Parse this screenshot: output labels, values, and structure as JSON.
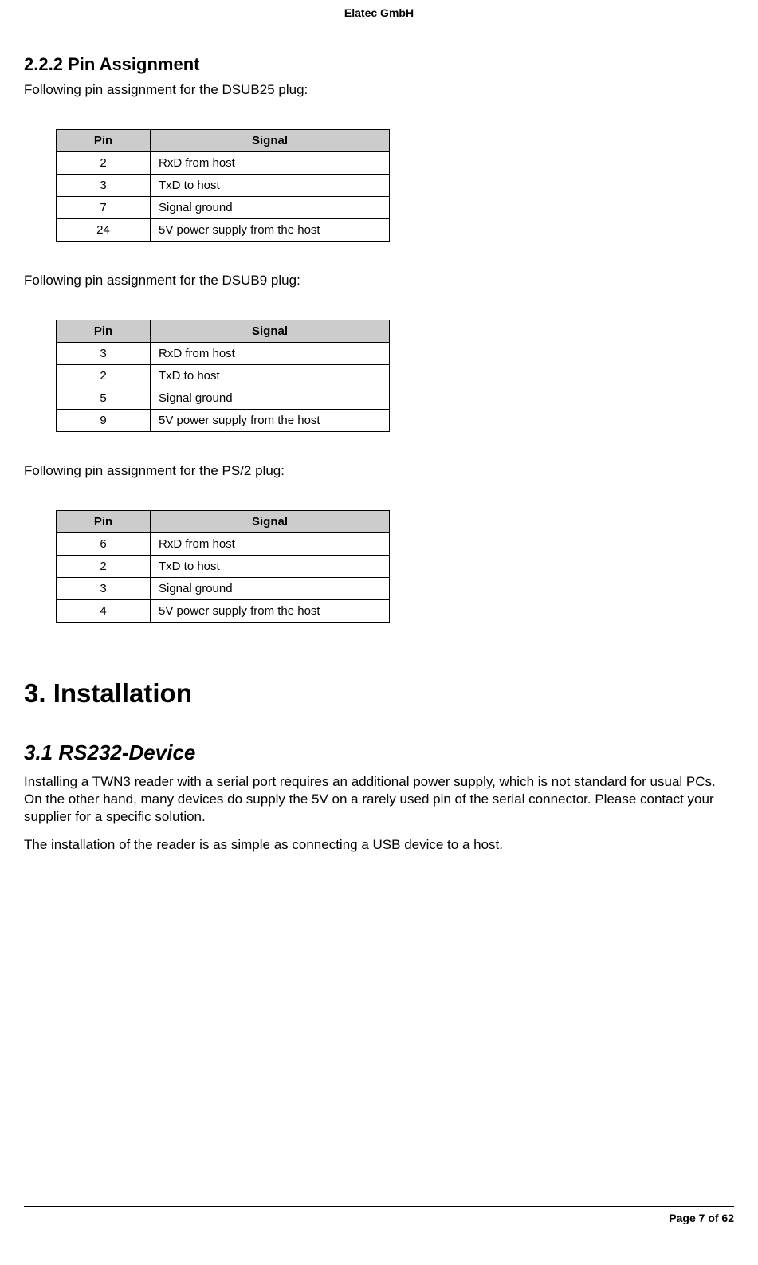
{
  "header": {
    "company": "Elatec GmbH"
  },
  "section_222": {
    "heading": "2.2.2  Pin Assignment",
    "intro_dsub25": "Following pin assignment for the DSUB25 plug:",
    "intro_dsub9": "Following pin assignment for the DSUB9 plug:",
    "intro_ps2": "Following pin assignment for the PS/2 plug:",
    "col_pin": "Pin",
    "col_signal": "Signal",
    "table_dsub25": [
      {
        "pin": "2",
        "signal": "RxD from host"
      },
      {
        "pin": "3",
        "signal": "TxD to host"
      },
      {
        "pin": "7",
        "signal": "Signal ground"
      },
      {
        "pin": "24",
        "signal": "5V power supply from the host"
      }
    ],
    "table_dsub9": [
      {
        "pin": "3",
        "signal": "RxD from host"
      },
      {
        "pin": "2",
        "signal": "TxD to host"
      },
      {
        "pin": "5",
        "signal": "Signal ground"
      },
      {
        "pin": "9",
        "signal": "5V power supply from the host"
      }
    ],
    "table_ps2": [
      {
        "pin": "6",
        "signal": "RxD from host"
      },
      {
        "pin": "2",
        "signal": "TxD to host"
      },
      {
        "pin": "3",
        "signal": "Signal ground"
      },
      {
        "pin": "4",
        "signal": "5V power supply from the host"
      }
    ]
  },
  "section_3": {
    "heading": "3. Installation"
  },
  "section_31": {
    "heading": "3.1  RS232-Device",
    "para1": "Installing a TWN3 reader with a serial port requires an additional power supply, which is not standard for usual PCs. On the other hand, many devices do supply the 5V on a rarely used pin of the serial connector. Please contact your supplier for a specific solution.",
    "para2": "The installation of the reader is as simple as connecting a USB device to a host."
  },
  "footer": {
    "page": "Page 7 of 62"
  }
}
